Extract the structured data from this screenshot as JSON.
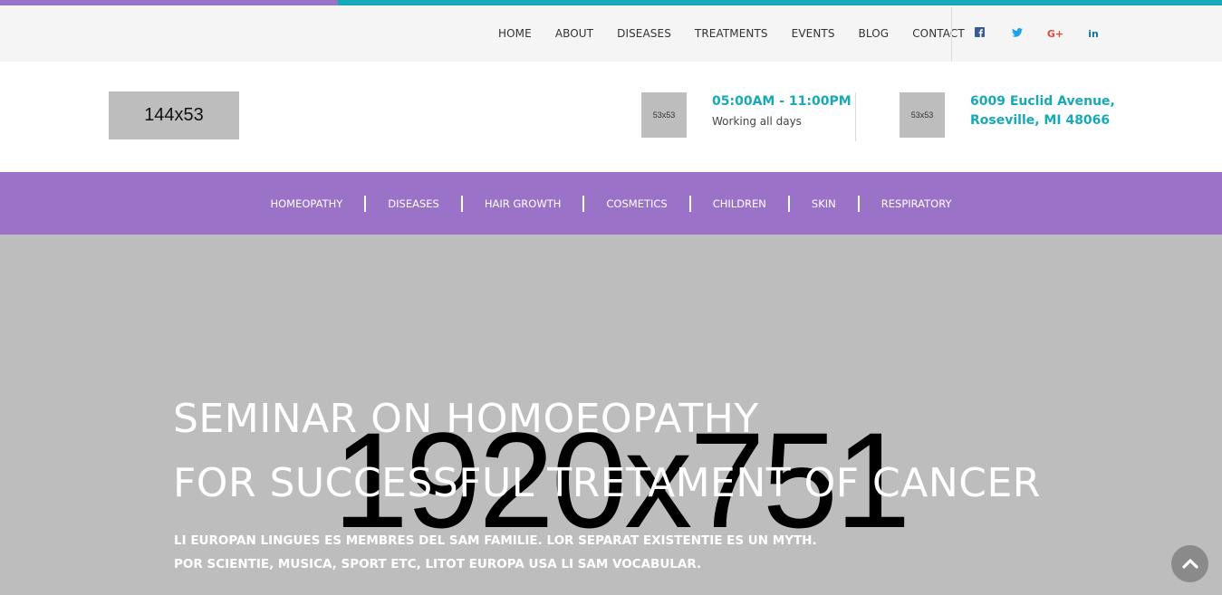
{
  "colors": {
    "accent_purple": "#9a72c8",
    "accent_teal": "#17a9b8",
    "topnav_bg": "#f5f5f5",
    "hero_bg": "#bdbdbd",
    "facebook": "#3b5998",
    "twitter": "#1da1f2",
    "google_plus": "#dd4b39",
    "linkedin": "#0e76a8"
  },
  "topnav": {
    "menu": [
      "HOME",
      "ABOUT",
      "DISEASES",
      "TREATMENTS",
      "EVENTS",
      "BLOG",
      "CONTACT"
    ],
    "social": [
      {
        "icon": "facebook-icon",
        "glyph": "f"
      },
      {
        "icon": "twitter-icon",
        "glyph": "❧"
      },
      {
        "icon": "google-plus-icon",
        "glyph": "G+"
      },
      {
        "icon": "linkedin-icon",
        "glyph": "in"
      }
    ]
  },
  "header": {
    "logo_placeholder": "144x53",
    "hours": {
      "icon_placeholder": "53x53",
      "title": "05:00AM - 11:00PM",
      "subtitle": "Working all days"
    },
    "address": {
      "icon_placeholder": "53x53",
      "line1": "6009 Euclid Avenue,",
      "line2": "Roseville, MI 48066"
    }
  },
  "categories": [
    "HOMEOPATHY",
    "DISEASES",
    "HAIR GROWTH",
    "COSMETICS",
    "CHILDREN",
    "SKIN",
    "RESPIRATORY"
  ],
  "hero": {
    "image_placeholder": "1920x751",
    "title_line1": "SEMINAR ON HOMOEOPATHY",
    "title_line2": "FOR SUCCESSFUL TRETAMENT OF CANCER",
    "subtitle_line1": "LI EUROPAN LINGUES ES MEMBRES DEL SAM FAMILIE. LOR SEPARAT EXISTENTIE ES UN MYTH.",
    "subtitle_line2": "POR SCIENTIE, MUSICA, SPORT ETC, LITOT EUROPA USA LI SAM VOCABULAR."
  }
}
